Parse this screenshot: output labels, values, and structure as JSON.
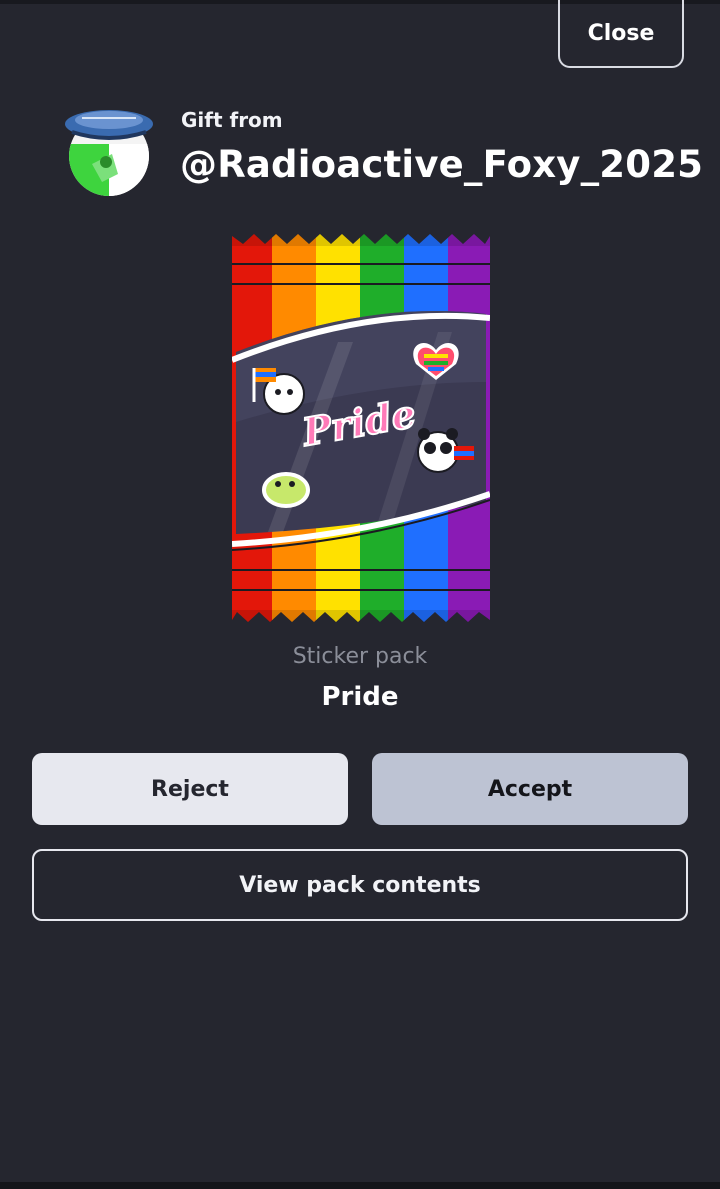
{
  "header": {
    "close_label": "Close"
  },
  "gift": {
    "from_label": "Gift from",
    "username": "@Radioactive_Foxy_2025"
  },
  "pack": {
    "type_label": "Sticker pack",
    "name": "Pride",
    "sticker_text": "Pride",
    "stripe_colors": [
      "#e3170a",
      "#ff8a00",
      "#ffe100",
      "#1fae2a",
      "#1f6fff",
      "#8a1bb5"
    ]
  },
  "actions": {
    "reject_label": "Reject",
    "accept_label": "Accept",
    "view_contents_label": "View pack contents"
  }
}
